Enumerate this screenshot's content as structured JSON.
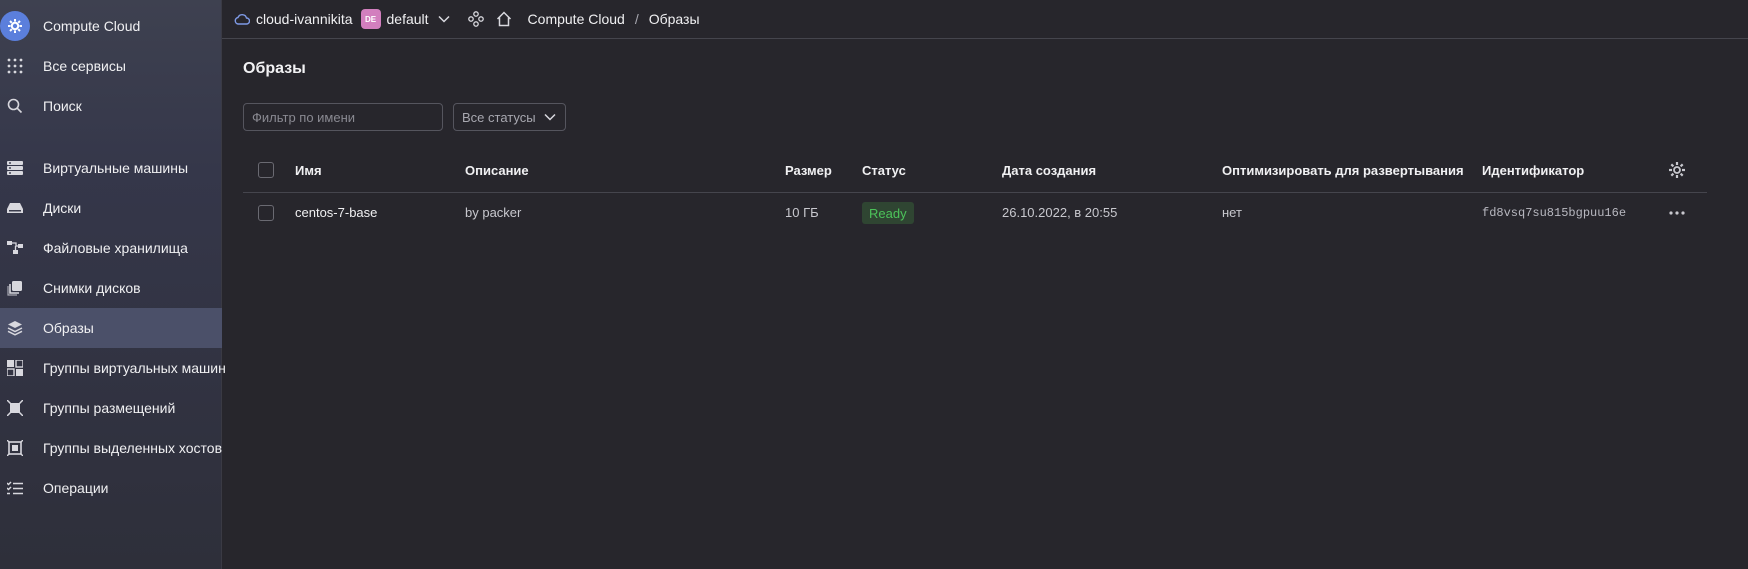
{
  "sidebar": {
    "app_title": "Compute Cloud",
    "all_services": "Все сервисы",
    "search": "Поиск",
    "items": [
      {
        "label": "Виртуальные машины",
        "icon": "vm-icon"
      },
      {
        "label": "Диски",
        "icon": "disk-icon"
      },
      {
        "label": "Файловые хранилища",
        "icon": "file-storage-icon"
      },
      {
        "label": "Снимки дисков",
        "icon": "snapshot-icon"
      },
      {
        "label": "Образы",
        "icon": "layers-icon",
        "active": true
      },
      {
        "label": "Группы виртуальных машин",
        "icon": "instance-group-icon"
      },
      {
        "label": "Группы размещений",
        "icon": "placement-group-icon"
      },
      {
        "label": "Группы выделенных хостов",
        "icon": "dedicated-host-icon"
      },
      {
        "label": "Операции",
        "icon": "operations-icon"
      }
    ]
  },
  "topbar": {
    "cloud": "cloud-ivannikita",
    "folder_badge": "DE",
    "folder": "default",
    "breadcrumb_service": "Compute Cloud",
    "breadcrumb_separator": "/",
    "breadcrumb_page": "Образы"
  },
  "main": {
    "title": "Образы",
    "filter_placeholder": "Фильтр по имени",
    "status_filter": "Все статусы",
    "columns": {
      "name": "Имя",
      "description": "Описание",
      "size": "Размер",
      "status": "Статус",
      "created": "Дата создания",
      "optimize": "Оптимизировать для развертывания",
      "id": "Идентификатор"
    },
    "rows": [
      {
        "name": "centos-7-base",
        "description": "by packer",
        "size": "10 ГБ",
        "status": "Ready",
        "created": "26.10.2022, в 20:55",
        "optimize": "нет",
        "id": "fd8vsq7su815bgpuu16e"
      }
    ]
  },
  "colors": {
    "accent": "#5b7fdc",
    "status_ready_text": "#4cc35a",
    "status_ready_bg": "#2f4532",
    "sidebar_active": "#4b5069",
    "background": "#27262c"
  }
}
